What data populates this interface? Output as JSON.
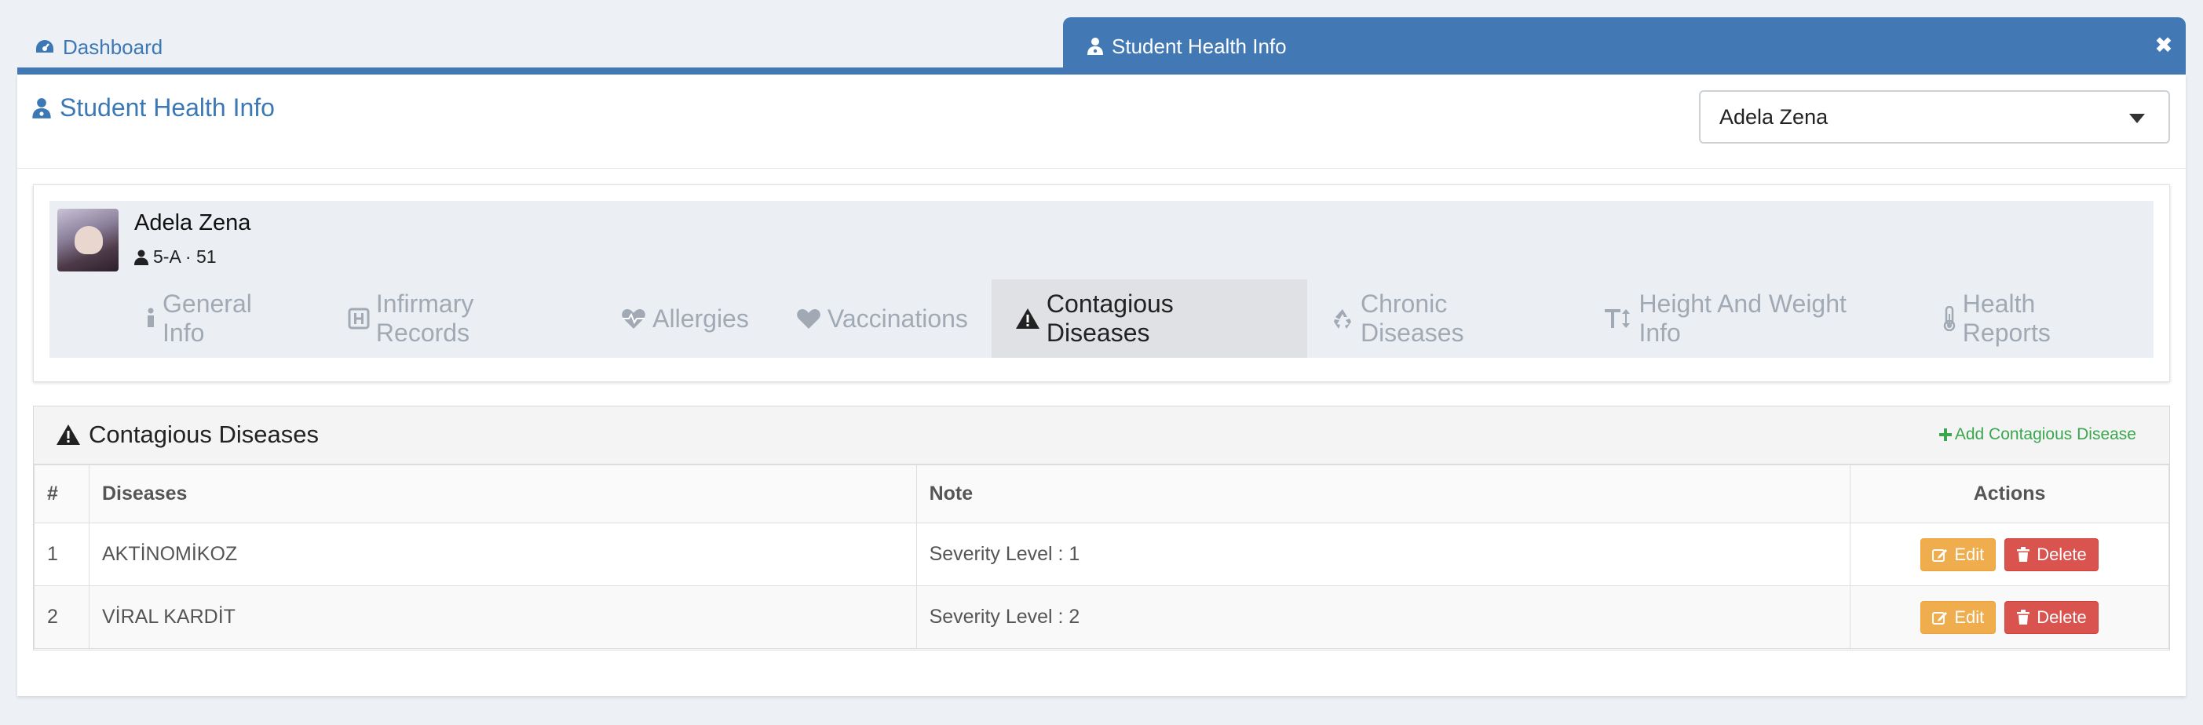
{
  "tabs": {
    "dashboard": "Dashboard",
    "active": "Student Health Info",
    "close_symbol": "✖"
  },
  "header": {
    "title": "Student Health Info",
    "student_select_value": "Adela Zena"
  },
  "student": {
    "name": "Adela Zena",
    "meta": "5-A · 51"
  },
  "nav": {
    "items": [
      {
        "label": "General Info",
        "icon": "info-icon"
      },
      {
        "label": "Infirmary Records",
        "icon": "hospital-icon"
      },
      {
        "label": "Allergies",
        "icon": "heartbeat-icon"
      },
      {
        "label": "Vaccinations",
        "icon": "heart-icon"
      },
      {
        "label": "Contagious Diseases",
        "icon": "warning-icon",
        "active": true
      },
      {
        "label": "Chronic Diseases",
        "icon": "recycle-icon"
      },
      {
        "label": "Height And Weight Info",
        "icon": "text-height-icon"
      },
      {
        "label": "Health Reports",
        "icon": "thermometer-icon"
      }
    ]
  },
  "diseases": {
    "title": "Contagious Diseases",
    "add_label": "Add Contagious Disease",
    "columns": [
      "#",
      "Diseases",
      "Note",
      "Actions"
    ],
    "rows": [
      {
        "num": "1",
        "disease": "AKTİNOMİKOZ",
        "note": "Severity Level : 1"
      },
      {
        "num": "2",
        "disease": "VİRAL KARDİT",
        "note": "Severity Level : 2"
      }
    ],
    "edit_label": "Edit",
    "delete_label": "Delete"
  },
  "colors": {
    "primary": "#4279b4",
    "link": "#3c78b4",
    "success": "#3aa64f",
    "warning": "#f0ad4e",
    "danger": "#d9534f"
  }
}
